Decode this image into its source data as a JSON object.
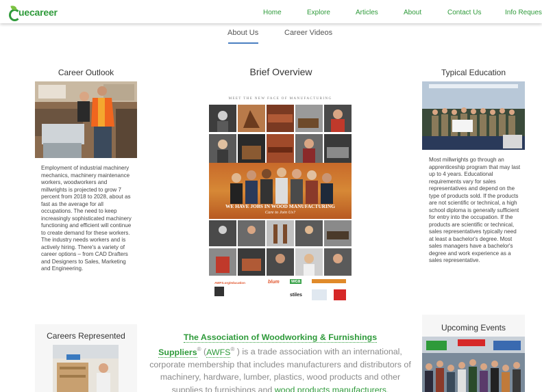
{
  "brand": {
    "logo_text": "uecareer",
    "logo_c": "C"
  },
  "nav": {
    "items": [
      "Home",
      "Explore",
      "Articles",
      "About",
      "Contact Us",
      "Info Request"
    ]
  },
  "tabs": {
    "about": "About Us",
    "videos": "Career Videos",
    "active": "About Us"
  },
  "career_outlook": {
    "title": "Career Outlook",
    "text": "Employment of industrial machinery mechanics, machinery maintenance workers, woodworkers and millwrights is projected to grow 7 percent from 2018 to 2028, about as fast as the average for all occupations. The need to keep increasingly sophisticated machinery functioning and efficient will continue to create demand for these workers. The industry needs workers and is actively hiring.  There's a variety of career options – from CAD Drafters and Designers to Sales, Marketing and Engineering."
  },
  "brief_overview": {
    "title": "Brief Overview",
    "poster_header": "MEET THE NEW FACE OF MANUFACTURING",
    "poster_title": "WE HAVE JOBS IN WOOD MANUFACTURING",
    "poster_subtitle": "Care to Join Us?",
    "poster_url": "AWFS.org/education",
    "poster_logos": {
      "blum": "blum",
      "wca": "wca",
      "stiles": "stiles"
    }
  },
  "typical_education": {
    "title": "Typical Education",
    "text": "Most millwrights go through an apprenticeship program that may last up to 4 years.  Educational requirements vary for sales representatives and depend on the type of products sold. If the products are not scientific or technical, a high school diploma is generally sufficient for entry into the occupation. If the products are scientific or technical, sales representatives typically need at least a bachelor's degree.  Most sales managers have a bachelor's degree and work experience as a sales representative."
  },
  "careers_represented": {
    "title": "Careers Represented"
  },
  "upcoming_events": {
    "title": "Upcoming Events"
  },
  "description": {
    "org_line1": "The Association of Woodworking & Furnishings",
    "org_line2": "Suppliers",
    "reg": "®",
    "open_paren": " (",
    "abbr": "AWFS",
    "after_abbr": " ) is a trade association with an international,",
    "line3": "corporate membership that includes manufacturers and distributors of",
    "line4": "machinery, hardware, lumber, plastics, wood products and other",
    "line5_pre": "supplies to furnishings and ",
    "line5_link": "wood products manufacturers",
    "line5_post": "."
  },
  "colors": {
    "brand_green": "#2e9a3a",
    "tab_accent": "#4a7fc1",
    "poster_orange": "#d68836"
  }
}
